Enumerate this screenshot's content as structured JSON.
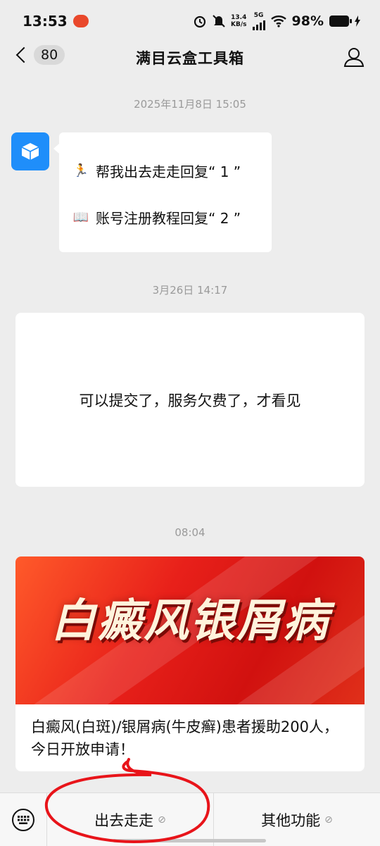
{
  "status_bar": {
    "time": "13:53",
    "net_speed_value": "13.4",
    "net_speed_unit": "KB/s",
    "network": "5G",
    "battery": "98%"
  },
  "nav": {
    "unread_count": "80",
    "title": "满目云盒工具箱"
  },
  "messages": {
    "time_1": "2025年11月8日 15:05",
    "bubble_line_1": "帮我出去走走回复“ 1 ”",
    "bubble_line_2": "账号注册教程回复“ 2 ”",
    "time_2": "3月26日 14:17",
    "card_text": "可以提交了，服务欠费了，才看见",
    "time_3": "08:04",
    "article_banner": "白癜风银屑病",
    "article_title": "白癜风(白斑)/银屑病(牛皮癣)患者援助200人，今日开放申请！"
  },
  "bottom_menu": {
    "item_1": "出去走走",
    "item_2": "其他功能"
  },
  "colors": {
    "accent_blue": "#1f8efa",
    "banner_red": "#e8201a",
    "annotation_red": "#e8141a"
  }
}
